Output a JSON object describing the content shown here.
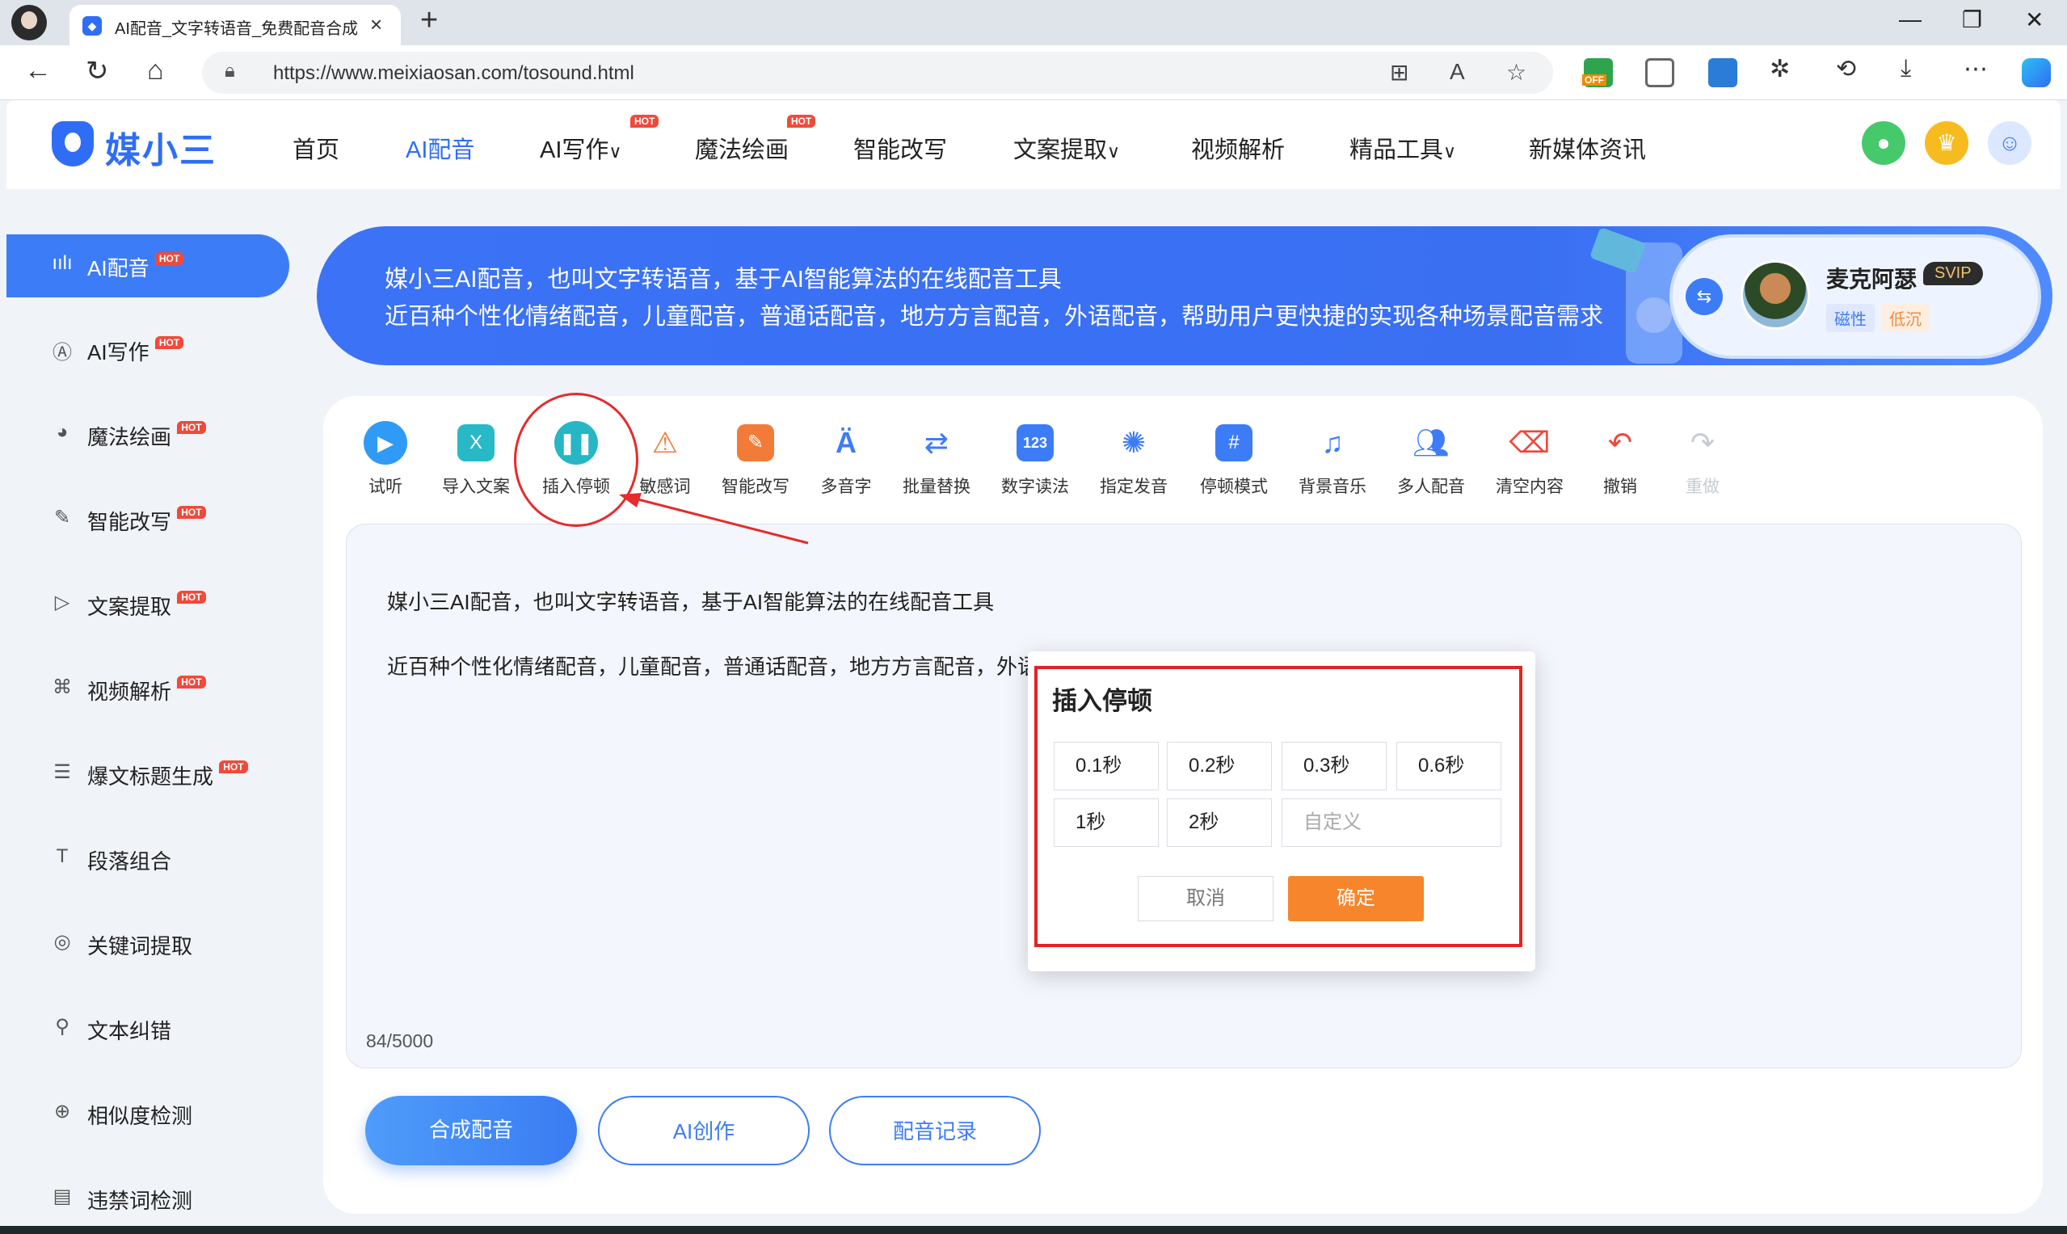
{
  "browser": {
    "tab_title": "AI配音_文字转语音_免费配音合成",
    "url": "https://www.meixiaosan.com/tosound.html",
    "ext_badge": "OFF"
  },
  "header": {
    "logo_text": "媒小三",
    "nav": [
      {
        "label": "首页"
      },
      {
        "label": "AI配音"
      },
      {
        "label": "AI写作",
        "caret": "∨"
      },
      {
        "label": "魔法绘画"
      },
      {
        "label": "智能改写"
      },
      {
        "label": "文案提取",
        "caret": "∨"
      },
      {
        "label": "视频解析"
      },
      {
        "label": "精品工具",
        "caret": "∨"
      },
      {
        "label": "新媒体资讯"
      }
    ],
    "hot_badge": "HOT"
  },
  "sidebar": {
    "items": [
      {
        "label": "AI配音"
      },
      {
        "label": "AI写作"
      },
      {
        "label": "魔法绘画"
      },
      {
        "label": "智能改写"
      },
      {
        "label": "文案提取"
      },
      {
        "label": "视频解析"
      },
      {
        "label": "爆文标题生成"
      },
      {
        "label": "段落组合"
      },
      {
        "label": "关键词提取"
      },
      {
        "label": "文本纠错"
      },
      {
        "label": "相似度检测"
      },
      {
        "label": "违禁词检测"
      }
    ]
  },
  "banner": {
    "line1": "媒小三AI配音，也叫文字转语音，基于AI智能算法的在线配音工具",
    "line2": "近百种个性化情绪配音，儿童配音，普通话配音，地方方言配音，外语配音，帮助用户更快捷的实现各种场景配音需求"
  },
  "voice_card": {
    "name": "麦克阿瑟",
    "badge": "SVIP",
    "tags": [
      "磁性",
      "低沉"
    ]
  },
  "toolbar": {
    "tools": [
      {
        "label": "试听"
      },
      {
        "label": "导入文案"
      },
      {
        "label": "插入停顿"
      },
      {
        "label": "敏感词"
      },
      {
        "label": "智能改写"
      },
      {
        "label": "多音字"
      },
      {
        "label": "批量替换"
      },
      {
        "label": "数字读法"
      },
      {
        "label": "指定发音"
      },
      {
        "label": "停顿模式"
      },
      {
        "label": "背景音乐"
      },
      {
        "label": "多人配音"
      },
      {
        "label": "清空内容"
      },
      {
        "label": "撤销"
      },
      {
        "label": "重做"
      }
    ]
  },
  "editor": {
    "line1": "媒小三AI配音，也叫文字转语音，基于AI智能算法的在线配音工具",
    "line2": "近百种个性化情绪配音，儿童配音，普通话配音，地方方言配音，外语配音，帮助用户更快捷的实现各种场景配音需求",
    "char_count": "84/5000"
  },
  "actions": {
    "synthesize": "合成配音",
    "ai_create": "AI创作",
    "records": "配音记录"
  },
  "dialog": {
    "title": "插入停顿",
    "options": [
      "0.1秒",
      "0.2秒",
      "0.3秒",
      "0.6秒",
      "1秒",
      "2秒"
    ],
    "custom_placeholder": "自定义",
    "cancel": "取消",
    "confirm": "确定"
  },
  "colors": {
    "brand_blue": "#3d7cf7",
    "accent_orange": "#f6852c",
    "annotation_red": "#e52b2b"
  }
}
